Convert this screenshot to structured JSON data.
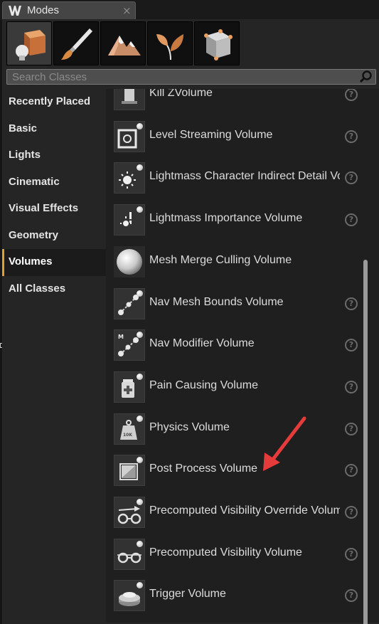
{
  "window": {
    "tab_title": "Modes",
    "close_glyph": "×"
  },
  "modes": [
    {
      "name": "place-mode",
      "icon": "placement-cube-icon",
      "active": true
    },
    {
      "name": "paint-mode",
      "icon": "paintbrush-icon",
      "active": false
    },
    {
      "name": "landscape-mode",
      "icon": "mountain-icon",
      "active": false
    },
    {
      "name": "foliage-mode",
      "icon": "leaf-icon",
      "active": false
    },
    {
      "name": "geometry-mode",
      "icon": "geometry-cube-icon",
      "active": false
    }
  ],
  "search": {
    "placeholder": "Search Classes",
    "value": ""
  },
  "categories": [
    {
      "label": "Recently Placed",
      "active": false
    },
    {
      "label": "Basic",
      "active": false
    },
    {
      "label": "Lights",
      "active": false
    },
    {
      "label": "Cinematic",
      "active": false
    },
    {
      "label": "Visual Effects",
      "active": false
    },
    {
      "label": "Geometry",
      "active": false
    },
    {
      "label": "Volumes",
      "active": true
    },
    {
      "label": "All Classes",
      "active": false
    }
  ],
  "items": [
    {
      "label": "Kill ZVolume",
      "icon": "kill-z-volume-icon",
      "help": "?"
    },
    {
      "label": "Level Streaming Volume",
      "icon": "level-streaming-icon",
      "help": "?"
    },
    {
      "label": "Lightmass Character Indirect Detail Volume",
      "icon": "lightmass-sun-icon",
      "help": "?"
    },
    {
      "label": "Lightmass Importance Volume",
      "icon": "lightmass-importance-icon",
      "help": "?"
    },
    {
      "label": "Mesh Merge Culling Volume",
      "icon": "sphere-icon",
      "help": ""
    },
    {
      "label": "Nav Mesh Bounds Volume",
      "icon": "nav-mesh-icon",
      "help": "?"
    },
    {
      "label": "Nav Modifier Volume",
      "icon": "nav-modifier-icon",
      "help": "?"
    },
    {
      "label": "Pain Causing Volume",
      "icon": "pain-causing-icon",
      "help": "?"
    },
    {
      "label": "Physics Volume",
      "icon": "physics-weight-icon",
      "help": "?"
    },
    {
      "label": "Post Process Volume",
      "icon": "post-process-icon",
      "help": "?"
    },
    {
      "label": "Precomputed Visibility Override Volume",
      "icon": "visibility-override-icon",
      "help": "?"
    },
    {
      "label": "Precomputed Visibility Volume",
      "icon": "visibility-glasses-icon",
      "help": "?"
    },
    {
      "label": "Trigger Volume",
      "icon": "trigger-button-icon",
      "help": "?"
    }
  ],
  "colors": {
    "accent": "#e49d2c",
    "annotation_arrow": "#e53b3b"
  }
}
